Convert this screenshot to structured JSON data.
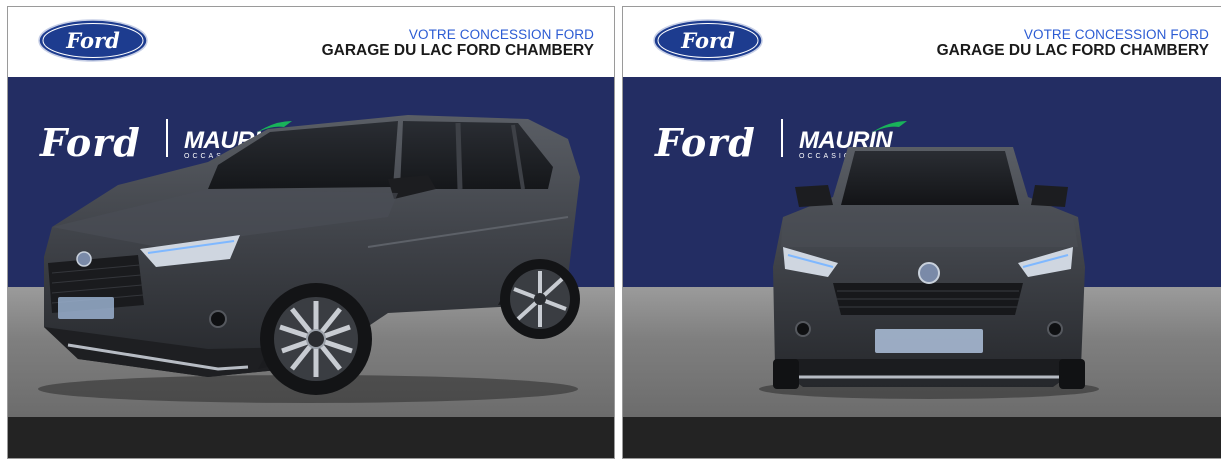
{
  "panels": [
    {
      "header": {
        "line1": "VOTRE CONCESSION FORD",
        "line2": "GARAGE DU LAC FORD CHAMBERY"
      },
      "brand": {
        "ford_logo_text": "Ford",
        "script_text": "Ford",
        "dealer_text": "MAURIN",
        "dealer_sub": "OCCASIONS"
      },
      "image": {
        "view": "three-quarter front",
        "car_color": "#3e4147"
      }
    },
    {
      "header": {
        "line1": "VOTRE CONCESSION FORD",
        "line2": "GARAGE DU LAC FORD CHAMBERY"
      },
      "brand": {
        "ford_logo_text": "Ford",
        "script_text": "Ford",
        "dealer_text": "MAURIN",
        "dealer_sub": "OCCASIONS"
      },
      "image": {
        "view": "front",
        "car_color": "#3e4147"
      }
    }
  ],
  "colors": {
    "banner": "#232d63",
    "ford_blue": "#1d3c8f",
    "header_accent": "#2b5bd3",
    "bottom_bar": "#232323",
    "maurin_green": "#19b35a"
  },
  "icons": [
    "ford-oval-logo",
    "maurin-swoosh"
  ]
}
